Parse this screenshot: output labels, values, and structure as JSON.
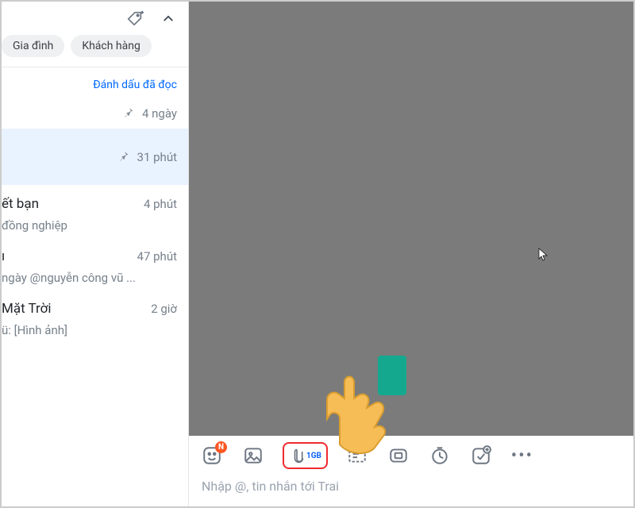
{
  "tags": {
    "t1": "Gia đình",
    "t2": "Khách hàng"
  },
  "mark_read": "Đánh dấu đã đọc",
  "pinned": {
    "a": "4 ngày",
    "b": "31 phút"
  },
  "g1": {
    "title": "ết bạn",
    "sub": "đồng nghiệp",
    "time": "4 phút"
  },
  "g2": {
    "title": "ı",
    "sub": "ngày @nguyễn công vũ ...",
    "time": "47 phút"
  },
  "g3": {
    "title": "Mặt Trời",
    "sub": "ü: [Hình ảnh]",
    "time": "2 giờ"
  },
  "attach_label": "1GB",
  "emoji_badge": "N",
  "input_placeholder": "Nhập @, tin nhắn tới Trai"
}
